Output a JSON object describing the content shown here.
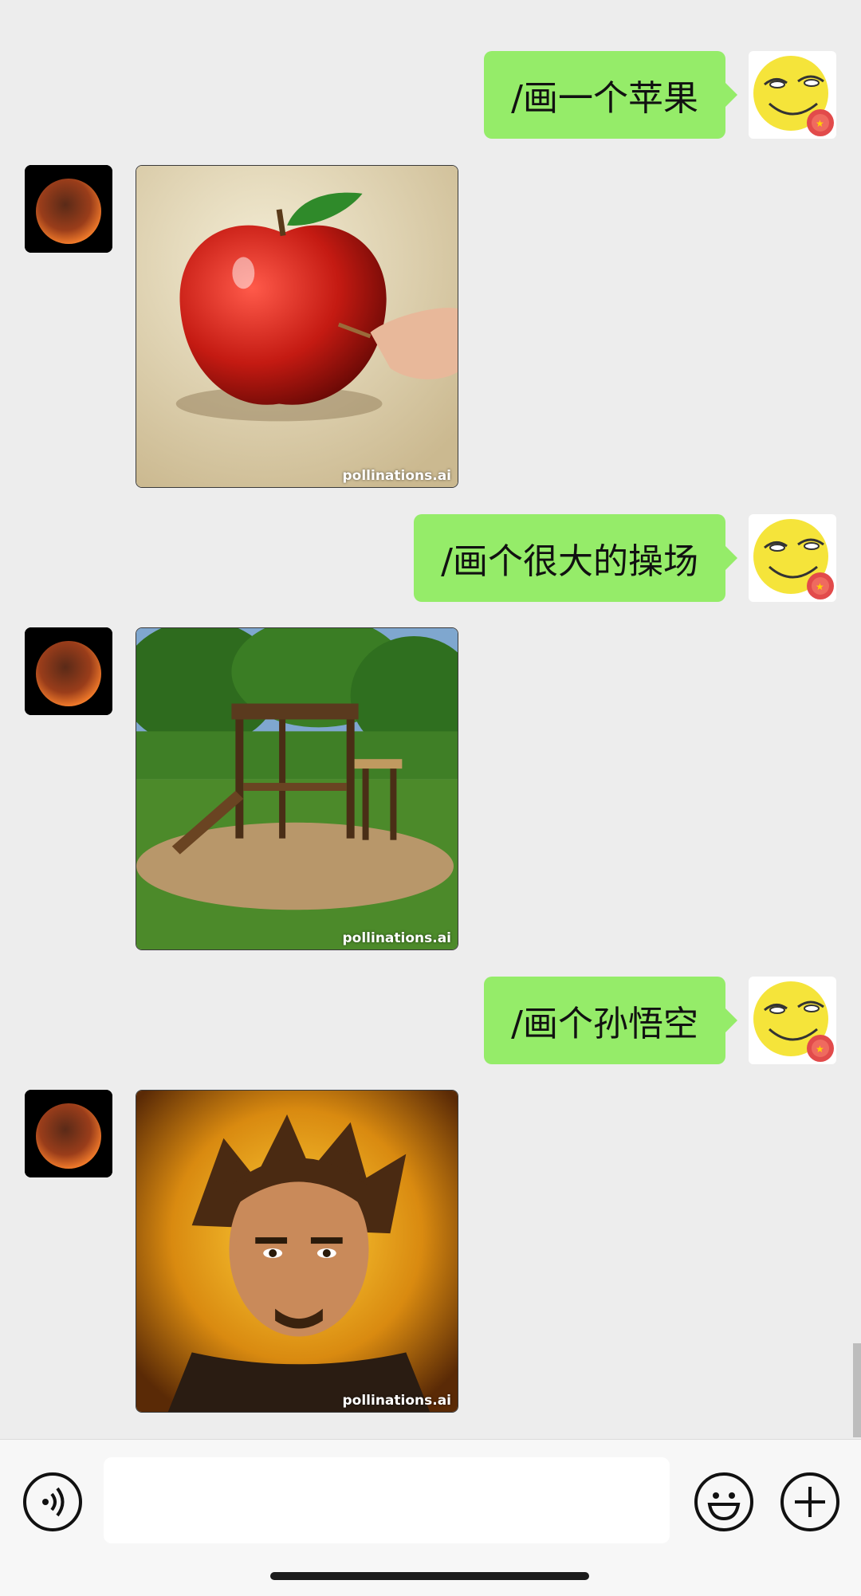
{
  "messages": [
    {
      "sender": "me",
      "text": "/画一个苹果"
    },
    {
      "sender": "bot",
      "image": "red apple being painted",
      "watermark": "pollinations.ai"
    },
    {
      "sender": "me",
      "text": "/画个很大的操场"
    },
    {
      "sender": "bot",
      "image": "wooden playground under trees",
      "watermark": "pollinations.ai"
    },
    {
      "sender": "me",
      "text": "/画个孙悟空"
    },
    {
      "sender": "bot",
      "image": "portrait of spiky-haired man",
      "watermark": "pollinations.ai"
    }
  ],
  "input": {
    "value": "",
    "placeholder": ""
  },
  "icons": {
    "voice": "voice-icon",
    "emoji": "emoji-icon",
    "plus": "plus-icon",
    "user_avatar": "smirk-emoji-avatar",
    "bot_avatar": "moon-avatar"
  },
  "colors": {
    "bubble": "#95ec69",
    "background": "#ededed",
    "bar": "#f7f7f7"
  }
}
